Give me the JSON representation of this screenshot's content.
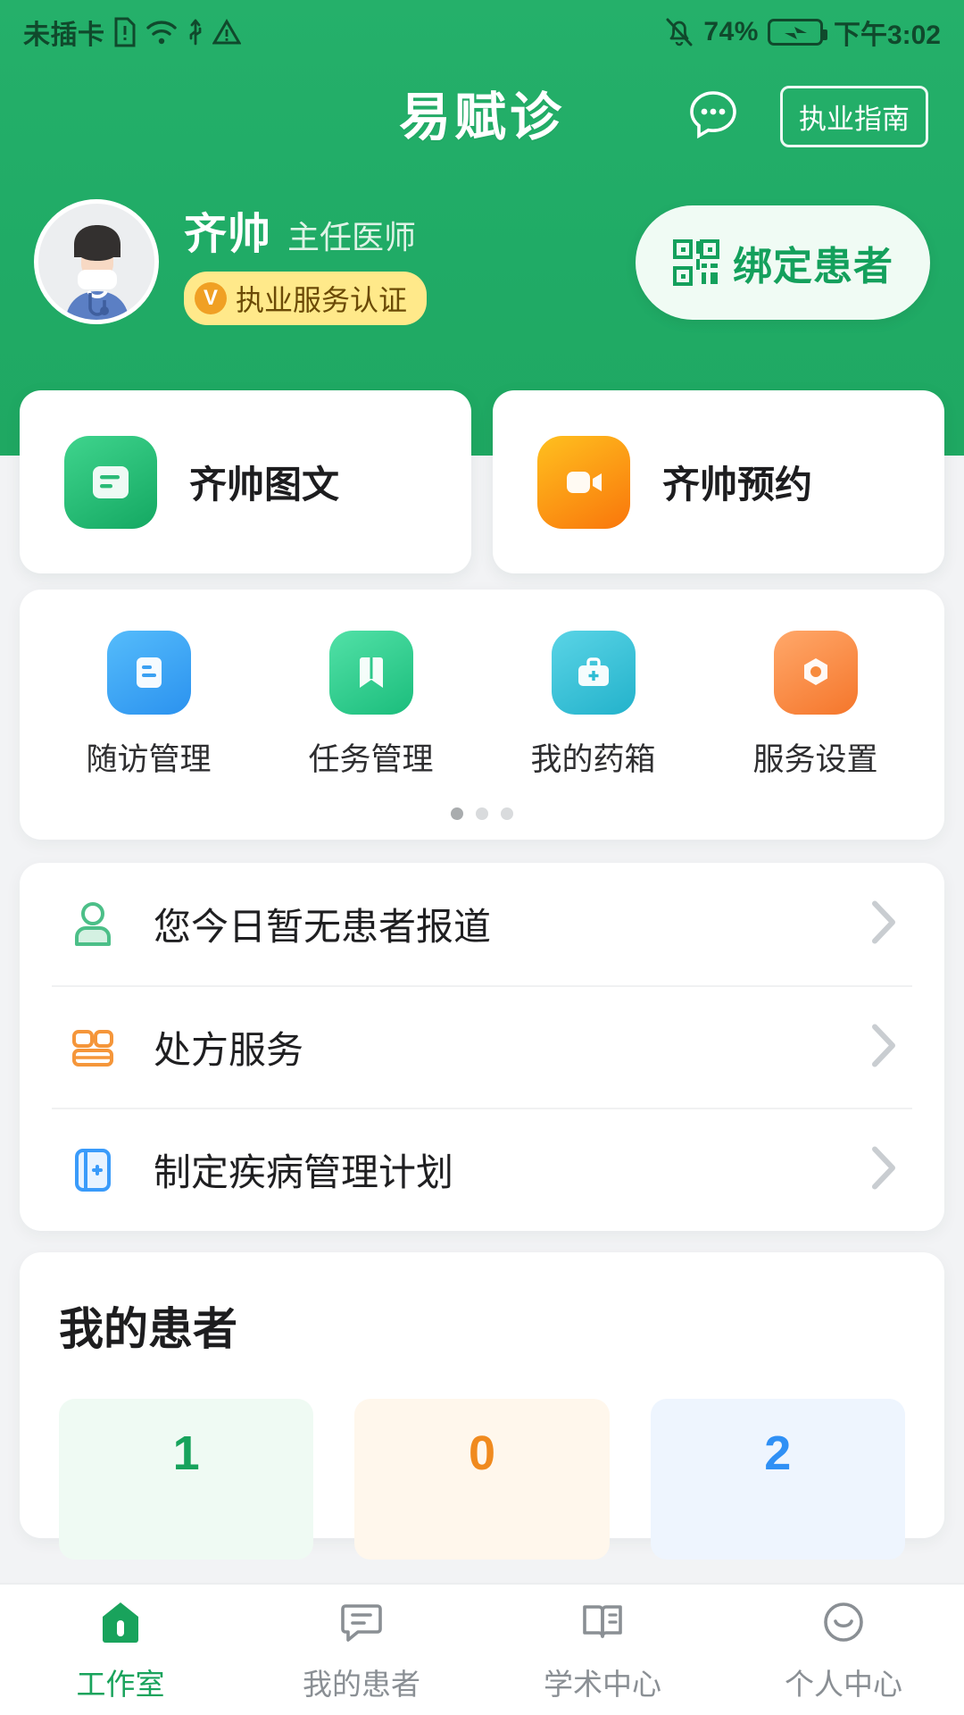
{
  "theme": {
    "brand_green": "#22b06a",
    "accent_green": "#19a35c",
    "orange": "#f5a623",
    "blue": "#3399ff"
  },
  "status_bar": {
    "carrier": "未插卡",
    "icons": [
      "sim-alert-icon",
      "wifi-icon",
      "usb-icon",
      "warning-icon"
    ],
    "mute_icon": "bell-off-icon",
    "battery": "74%",
    "battery_icon": "battery-charging-icon",
    "time": "下午3:02"
  },
  "header": {
    "brand": "易赋诊",
    "chat_icon": "chat-bubble-icon",
    "guide_button": "执业指南"
  },
  "profile": {
    "avatar_icon": "doctor-avatar",
    "name": "齐帅",
    "title": "主任医师",
    "cert_mark": "V",
    "cert_text": "执业服务认证",
    "bind_icon": "qr-scan-icon",
    "bind_label": "绑定患者"
  },
  "service_cards": [
    {
      "label": "齐帅图文",
      "icon": "text-consult-icon",
      "color_from": "#36cf86",
      "color_to": "#16ab63"
    },
    {
      "label": "齐帅预约",
      "icon": "video-appointment-icon",
      "color_from": "#ffb300",
      "color_to": "#f97c0d"
    }
  ],
  "quick_grid": {
    "items": [
      {
        "label": "随访管理",
        "icon": "followup-icon",
        "color_from": "#4ab6fa",
        "color_to": "#2f96f0"
      },
      {
        "label": "任务管理",
        "icon": "task-bookmark-icon",
        "color_from": "#4bdca0",
        "color_to": "#1fc07e"
      },
      {
        "label": "我的药箱",
        "icon": "medicine-box-icon",
        "color_from": "#51cde0",
        "color_to": "#27b6ce"
      },
      {
        "label": "服务设置",
        "icon": "service-settings-icon",
        "color_from": "#fb9a55",
        "color_to": "#f5772c"
      }
    ],
    "dots": 3,
    "active_dot": 0
  },
  "list_rows": [
    {
      "text": "您今日暂无患者报道",
      "icon": "patient-person-icon",
      "color": "#4cbf88"
    },
    {
      "text": "处方服务",
      "icon": "prescription-icon",
      "color": "#f5963a"
    },
    {
      "text": "制定疾病管理计划",
      "icon": "disease-plan-icon",
      "color": "#3a9bfa"
    }
  ],
  "patients": {
    "title": "我的患者",
    "stats": [
      {
        "value": "1",
        "color": "#17a35c",
        "bg": "#effaf3"
      },
      {
        "value": "0",
        "color": "#f08a1e",
        "bg": "#fff7ec"
      },
      {
        "value": "2",
        "color": "#2f90f5",
        "bg": "#eef5fe"
      }
    ]
  },
  "bottom_nav": {
    "items": [
      {
        "label": "工作室",
        "icon": "workspace-home-icon",
        "active": true
      },
      {
        "label": "我的患者",
        "icon": "patients-chat-icon",
        "active": false
      },
      {
        "label": "学术中心",
        "icon": "academic-book-icon",
        "active": false
      },
      {
        "label": "个人中心",
        "icon": "profile-smile-icon",
        "active": false
      }
    ]
  }
}
